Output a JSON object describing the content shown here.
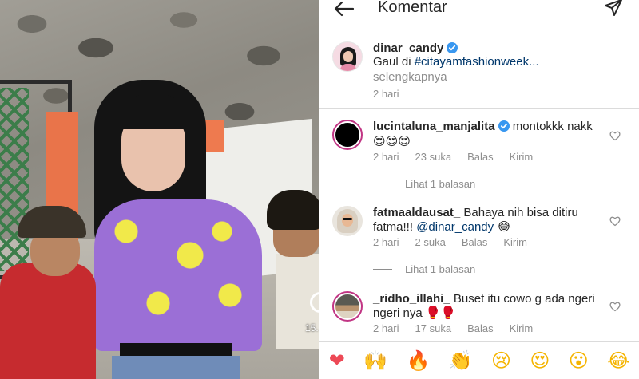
{
  "header": {
    "title": "Komentar"
  },
  "caption": {
    "username": "dinar_candy",
    "text_prefix": "Gaul di ",
    "hashtag": "#citayamfashionweek...",
    "more": "selengkapnya",
    "time": "2 hari"
  },
  "comments": [
    {
      "username": "lucintaluna_manjalita",
      "line1": "montokkk nakk",
      "line2": "😍😍😍",
      "time": "2 hari",
      "likes": "23 suka",
      "reply": "Balas",
      "send": "Kirim",
      "replies": "Lihat 1 balasan"
    },
    {
      "username": "fatmaaldausat_",
      "line1": "Bahaya nih bisa ditiru",
      "line2_prefix": "fatma!!! ",
      "mention": "@dinar_candy",
      "line2_suffix": " 😂",
      "time": "2 hari",
      "likes": "2 suka",
      "reply": "Balas",
      "send": "Kirim",
      "replies": "Lihat 1 balasan"
    },
    {
      "username": "_ridho_illahi_",
      "line1": "Buset itu cowo g ada ngeri",
      "line2": "ngeri nya 🥊🥊",
      "time": "2 hari",
      "likes": "17 suka",
      "reply": "Balas",
      "send": "Kirim"
    }
  ],
  "video": {
    "timestamp": "15."
  },
  "emoji_bar": [
    "❤",
    "🙌",
    "🔥",
    "👏",
    "😢",
    "😍",
    "😮",
    "😂"
  ],
  "colors": {
    "link": "#00376b",
    "muted": "#8e8e8e",
    "story_ring": "#c13584",
    "verified": "#3897f0"
  },
  "icons": [
    "back-arrow-icon",
    "send-icon",
    "verified-badge-icon",
    "heart-outline-icon"
  ]
}
